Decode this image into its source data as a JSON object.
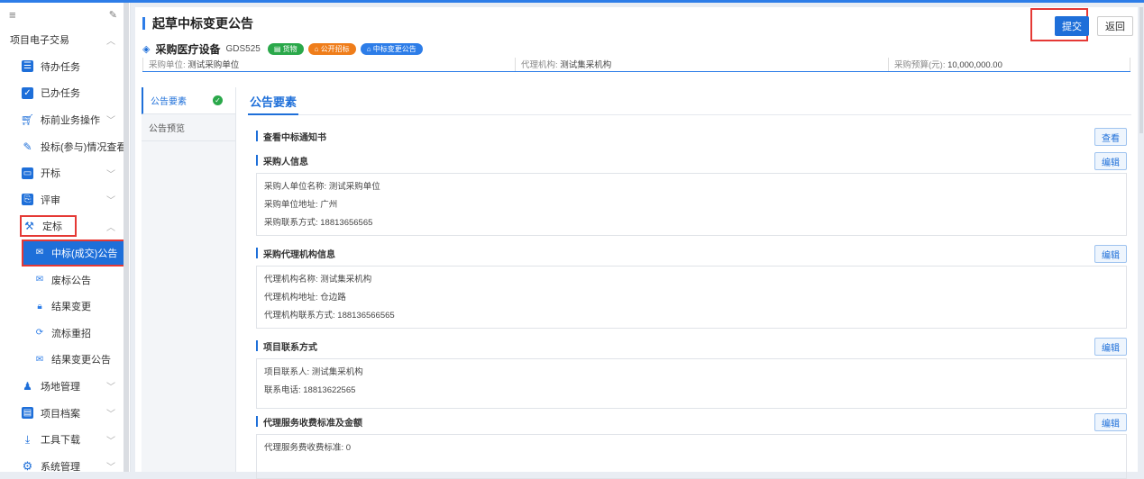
{
  "sidebar": {
    "section_title": "项目电子交易",
    "items": [
      {
        "label": "待办任务"
      },
      {
        "label": "已办任务"
      },
      {
        "label": "标前业务操作"
      },
      {
        "label": "投标(参与)情况查看"
      },
      {
        "label": "开标"
      },
      {
        "label": "评审"
      },
      {
        "label": "定标"
      }
    ],
    "sub_items": [
      {
        "label": "中标(成交)公告"
      },
      {
        "label": "废标公告"
      },
      {
        "label": "结果变更"
      },
      {
        "label": "流标重招"
      },
      {
        "label": "结果变更公告"
      }
    ],
    "bottom_items": [
      {
        "label": "场地管理"
      },
      {
        "label": "项目档案"
      },
      {
        "label": "工具下载"
      },
      {
        "label": "系统管理"
      }
    ]
  },
  "header": {
    "title": "起草中标变更公告",
    "submit_label": "提交",
    "back_label": "返回"
  },
  "project": {
    "name": "采购医疗设备",
    "code": "GDS525",
    "tags": [
      {
        "label": "货物",
        "color": "#2aa84a"
      },
      {
        "label": "公开招标",
        "color": "#ef7d1a"
      },
      {
        "label": "中标变更公告",
        "color": "#2d7de8"
      }
    ],
    "buyer_label": "采购单位:",
    "buyer_value": "测试采购单位",
    "agent_label": "代理机构:",
    "agent_value": "测试集采机构",
    "budget_label": "采购预算(元):",
    "budget_value": "10,000,000.00"
  },
  "tabs": [
    {
      "label": "公告要素"
    },
    {
      "label": "公告预览"
    }
  ],
  "content": {
    "title": "公告要素",
    "sections": [
      {
        "title": "查看中标通知书",
        "button": "查看"
      },
      {
        "title": "采购人信息",
        "button": "编辑",
        "lines": [
          "采购人单位名称:  测试采购单位",
          "采购单位地址:  广州",
          "采购联系方式:  18813656565"
        ]
      },
      {
        "title": "采购代理机构信息",
        "button": "编辑",
        "lines": [
          "代理机构名称: 测试集采机构",
          "代理机构地址:  仓边路",
          "代理机构联系方式:  188136566565"
        ]
      },
      {
        "title": "项目联系方式",
        "button": "编辑",
        "lines": [
          "项目联系人:  测试集采机构",
          "联系电话:  18813622565"
        ]
      },
      {
        "title": "代理服务收费标准及金额",
        "button": "编辑",
        "lines": [
          "代理服务费收费标准: 0"
        ]
      }
    ]
  },
  "colors": {
    "accent": "#1e6fd9",
    "highlight": "#e53935"
  }
}
